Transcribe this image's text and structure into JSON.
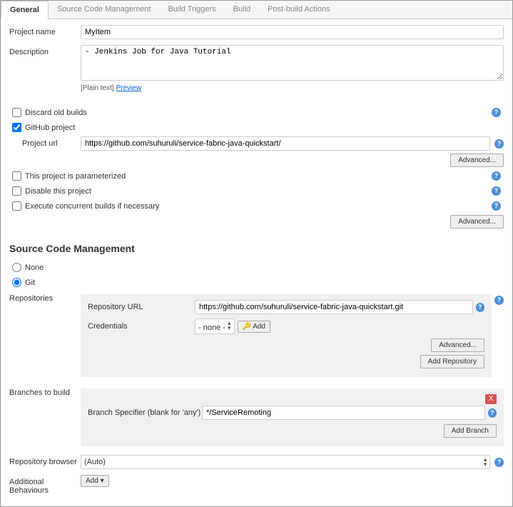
{
  "tabs": [
    "General",
    "Source Code Management",
    "Build Triggers",
    "Build",
    "Post-build Actions"
  ],
  "general": {
    "projectNameLabel": "Project name",
    "projectName": "MyItem",
    "descriptionLabel": "Description",
    "description": "- Jenkins Job for Java Tutorial",
    "plainText": "[Plain text]",
    "preview": "Preview",
    "discardOldBuilds": "Discard old builds",
    "githubProject": "GitHub project",
    "projectUrlLabel": "Project url",
    "projectUrl": "https://github.com/suhuruli/service-fabric-java-quickstart/",
    "advanced": "Advanced...",
    "parameterized": "This project is parameterized",
    "disable": "Disable this project",
    "concurrent": "Execute concurrent builds if necessary"
  },
  "scm": {
    "title": "Source Code Management",
    "none": "None",
    "git": "Git",
    "repositoriesLabel": "Repositories",
    "repoUrlLabel": "Repository URL",
    "repoUrl": "https://github.com/suhuruli/service-fabric-java-quickstart.git",
    "credentialsLabel": "Credentials",
    "credentialsValue": "- none -",
    "addCred": "Add",
    "addKeyIcon": "🔑",
    "advanced": "Advanced...",
    "addRepository": "Add Repository",
    "branchesLabel": "Branches to build",
    "branchSpecLabel": "Branch Specifier (blank for 'any')",
    "branchSpec": "*/ServiceRemoting",
    "deleteX": "X",
    "addBranch": "Add Branch",
    "repoBrowserLabel": "Repository browser",
    "repoBrowser": "(Auto)",
    "addlBehavioursLabel": "Additional Behaviours",
    "addBtn": "Add"
  }
}
